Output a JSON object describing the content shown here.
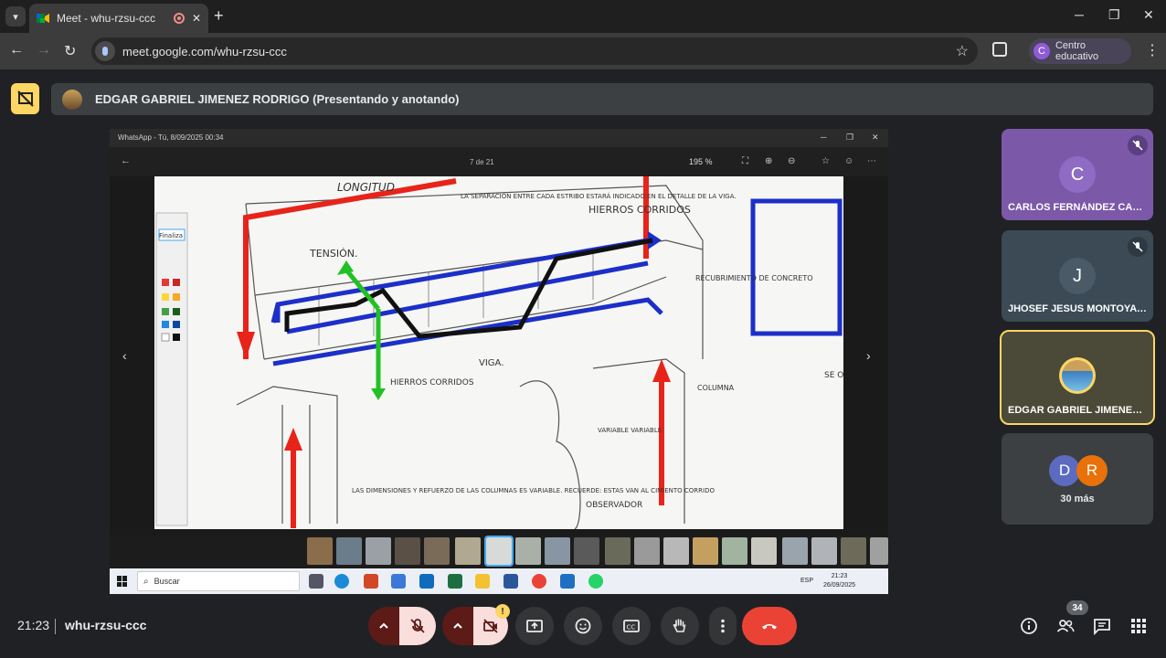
{
  "browser": {
    "tab_title": "Meet - whu-rzsu-ccc",
    "url": "meet.google.com/whu-rzsu-ccc",
    "profile_initial": "C",
    "profile_name": "Centro educativo"
  },
  "meet": {
    "presenter_label": "EDGAR GABRIEL JIMENEZ RODRIGO (Presentando y anotando)",
    "clock": "21:23",
    "meeting_code": "whu-rzsu-ccc",
    "people_count": "34",
    "warning_badge": "!"
  },
  "shared_screen": {
    "window_title": "WhatsApp - Tú, 8/09/2025 00:34",
    "page_indicator": "7 de 21",
    "zoom": "195 %",
    "taskbar_search": "Buscar",
    "taskbar_lang": "ESP",
    "taskbar_time": "21:23",
    "taskbar_date": "26/09/2025",
    "drawing_labels": {
      "longitud": "LONGITUD",
      "separacion": "LA SEPARACIÓN ENTRE CADA ESTRIBO ESTARÁ INDICADO EN EL DETALLE DE LA VIGA.",
      "hierros_top": "HIERROS CORRIDOS",
      "tension": "TENSIÓN.",
      "recubrimiento": "RECUBRIMIENTO DE CONCRETO",
      "viga": "VIGA.",
      "hierros_bottom": "HIERROS CORRIDOS",
      "columna": "COLUMNA",
      "variable": "VARIABLE VARIABLE",
      "dimensiones": "LAS DIMENSIONES Y REFUERZO DE LAS COLUMNAS ES VARIABLE. RECUERDE: ESTAS VAN AL CIMIENTO CORRIDO",
      "observador": "OBSERVADOR",
      "side_text": "SE Ob RA DE EL El PA EN"
    },
    "annot_palette_top": "Finaliza"
  },
  "participants": [
    {
      "initial": "C",
      "name": "CARLOS FERNÁNDEZ CALD...",
      "color": "#7b58a8",
      "avatar_color": "#8e6cc4",
      "muted": true
    },
    {
      "initial": "J",
      "name": "JHOSEF JESUS MONTOYA T...",
      "color": "#3b4a55",
      "avatar_color": "#4a5a66",
      "muted": true
    },
    {
      "initial": "",
      "name": "EDGAR GABRIEL JIMENEZ R...",
      "color": "#4b4a38",
      "avatar_color": "#c9a15a",
      "muted": false
    }
  ],
  "more_participants": {
    "circles": [
      {
        "initial": "D",
        "color": "#5c6bc0"
      },
      {
        "initial": "R",
        "color": "#e8710a"
      }
    ],
    "label": "30 más"
  },
  "colors": {
    "leave": "#ea4335",
    "muted_bg": "#f9dedc",
    "muted_dark": "#5c1b17",
    "control_bg": "#333537",
    "accent_yellow": "#fdd663"
  }
}
